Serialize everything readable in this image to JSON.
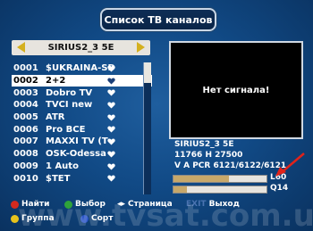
{
  "title": "Список ТВ каналов",
  "satellite": "SIRIUS2_3 5E",
  "channels": [
    {
      "num": "0001",
      "name": "$UKRAINA-SD",
      "fav": true,
      "selected": false
    },
    {
      "num": "0002",
      "name": "2+2",
      "fav": true,
      "selected": true
    },
    {
      "num": "0003",
      "name": "Dobro TV",
      "fav": true,
      "selected": false
    },
    {
      "num": "0004",
      "name": "TVCI new",
      "fav": true,
      "selected": false
    },
    {
      "num": "0005",
      "name": "ATR",
      "fav": true,
      "selected": false
    },
    {
      "num": "0006",
      "name": "Pro BCE",
      "fav": true,
      "selected": false
    },
    {
      "num": "0007",
      "name": "MAXXI TV (T",
      "fav": true,
      "selected": false
    },
    {
      "num": "0008",
      "name": "OSK-Odessa",
      "fav": true,
      "selected": false
    },
    {
      "num": "0009",
      "name": "1 Auto",
      "fav": true,
      "selected": false
    },
    {
      "num": "0010",
      "name": "$TET",
      "fav": true,
      "selected": false
    }
  ],
  "preview": {
    "message": "Нет сигнала!"
  },
  "info": {
    "satellite": "SIRIUS2_3   5E",
    "transponder": "11766  H  27500",
    "pids": "V  A  PCR  6121/6122/6121"
  },
  "signal": {
    "level_label": "L60",
    "level_value": 60,
    "quality_label": "Q14",
    "quality_value": 14
  },
  "legend": {
    "find": "Найти",
    "select": "Выбор",
    "page": "Страница",
    "exit_key": "EXIT",
    "exit": "Выход",
    "group": "Группа",
    "sort": "Сорт"
  },
  "colors": {
    "red": "#d42a1f",
    "green": "#2fa33a",
    "yellow": "#e7c21c",
    "blue": "#2c56c7",
    "selected_bg": "#ffffff"
  },
  "watermark": "www.tvsat.com.ua"
}
